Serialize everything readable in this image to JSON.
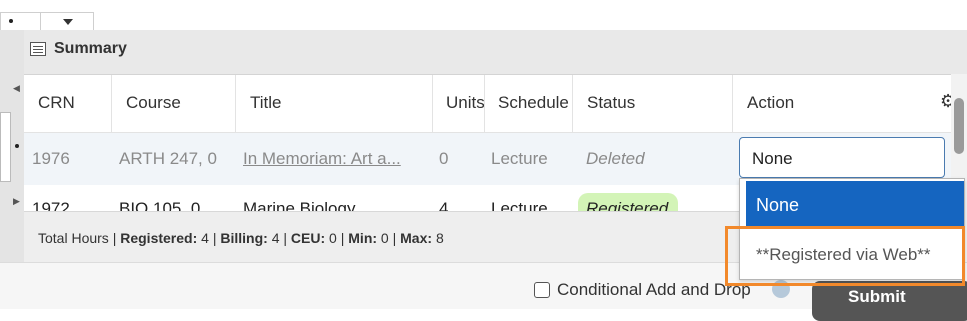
{
  "panel": {
    "title": "Summary"
  },
  "columns": [
    "CRN",
    "Course",
    "Title",
    "Units",
    "Schedule",
    "Status",
    "Action"
  ],
  "rows": [
    {
      "crn": "1976",
      "course": "ARTH 247, 0",
      "title": "In Memoriam: Art a...",
      "units": "0",
      "schedule": "Lecture",
      "status": "Deleted"
    },
    {
      "crn": "1972",
      "course": "BIO 105, 0",
      "title": "Marine Biology",
      "units": "4",
      "schedule": "Lecture",
      "status": "Registered"
    }
  ],
  "footer": {
    "total_hours": "Total Hours",
    "registered_label": "Registered:",
    "registered": "4",
    "billing_label": "Billing:",
    "billing": "4",
    "ceu_label": "CEU:",
    "ceu": "0",
    "min_label": "Min:",
    "min": "0",
    "max_label": "Max:",
    "max": "8"
  },
  "action_dropdown": {
    "selected": "None",
    "options": [
      "None",
      "**Registered via Web**"
    ]
  },
  "bottom": {
    "conditional_label": "Conditional Add and Drop",
    "submit_label": "Submit"
  },
  "colors": {
    "selected_option": "#1565c0",
    "highlight": "#f2892b",
    "registered_badge": "#d3f4b7"
  }
}
